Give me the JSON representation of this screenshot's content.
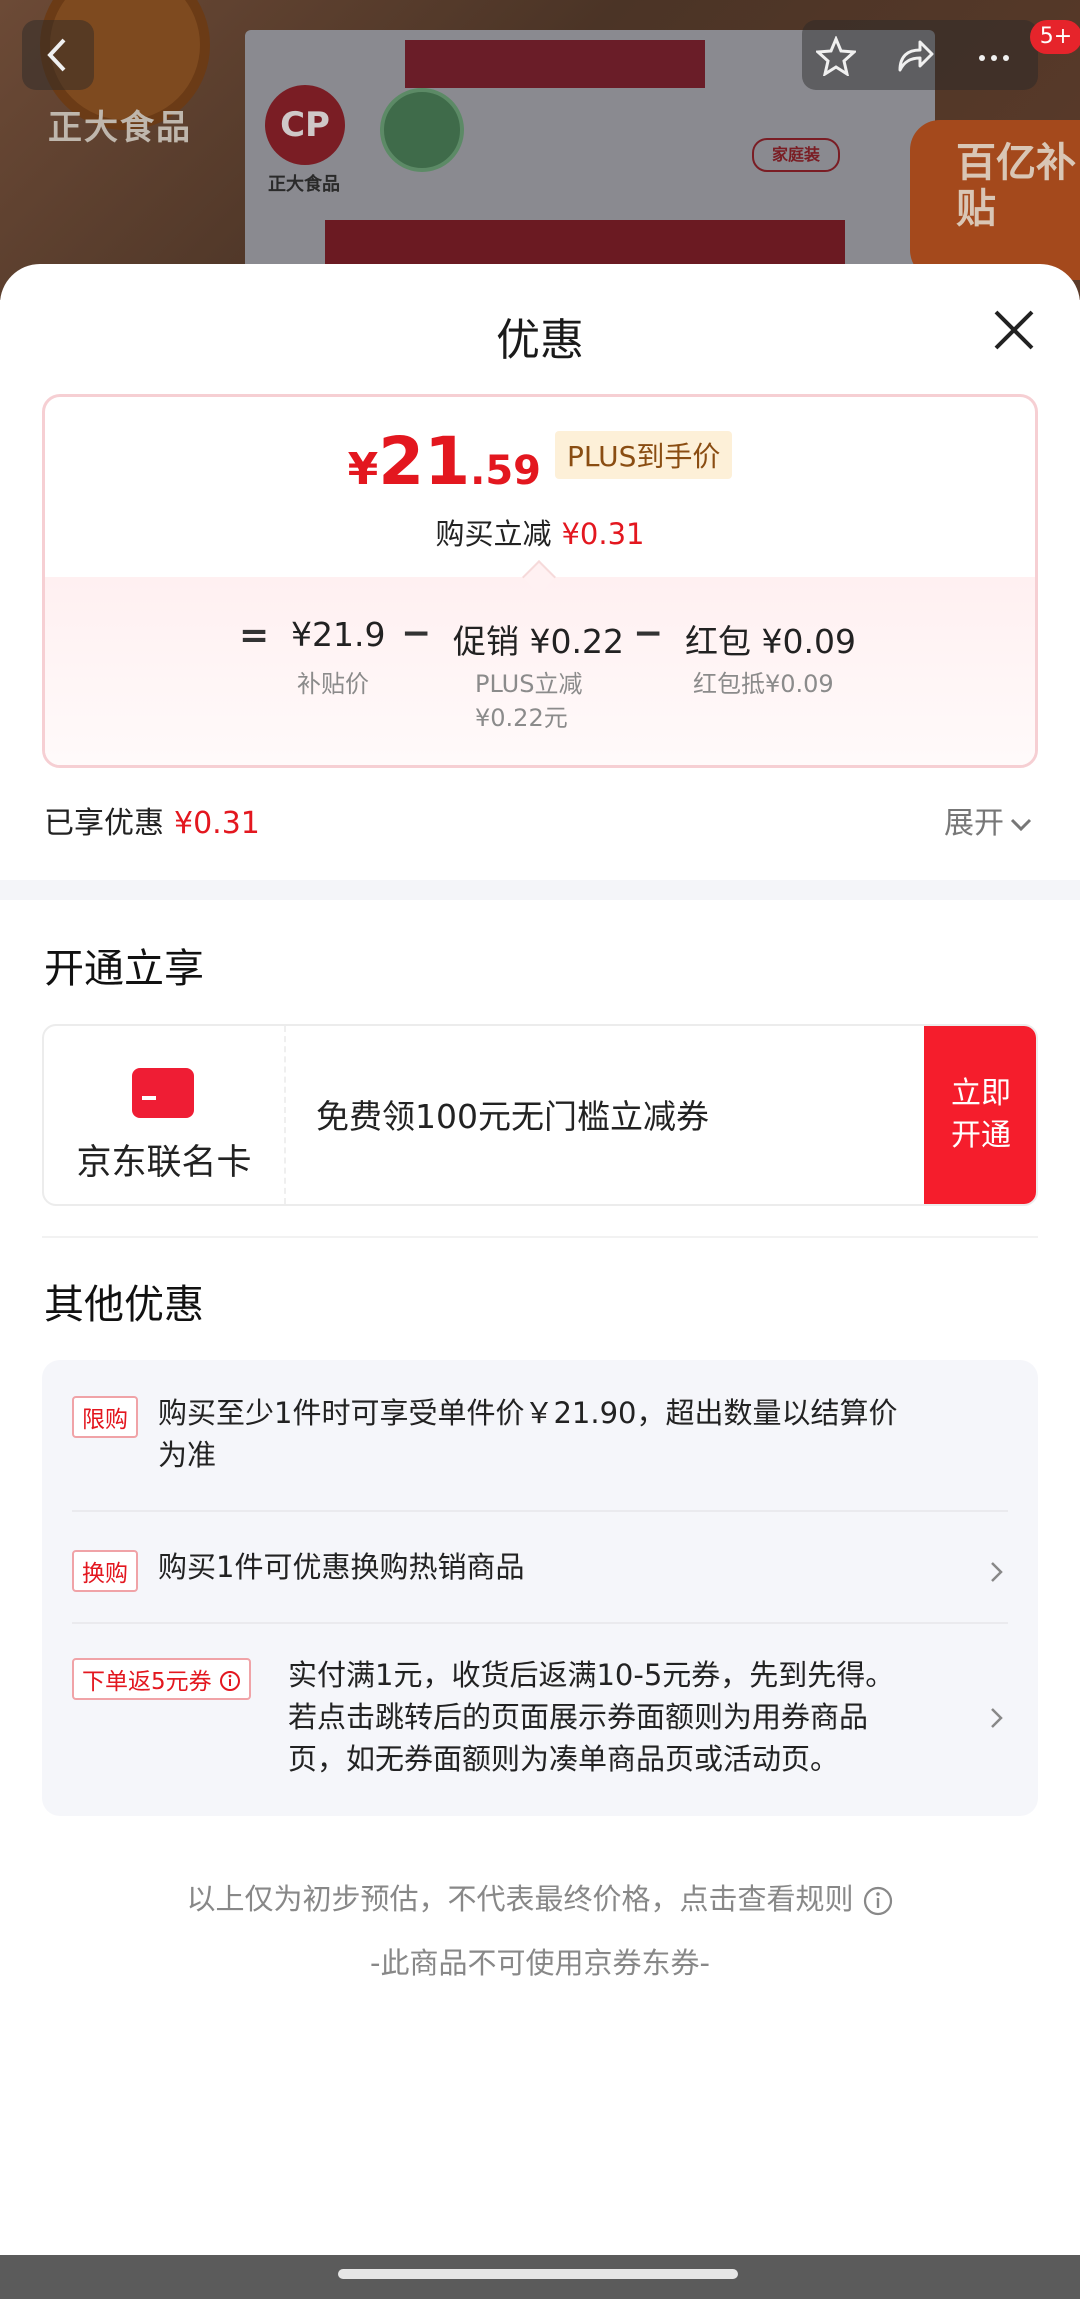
{
  "background": {
    "brand_text": "正大食品",
    "logo_text": "CP",
    "package_tag": "家庭装",
    "subsidy_badge": "百亿补贴",
    "notification_count": "5+"
  },
  "sheet": {
    "title": "优惠"
  },
  "price": {
    "currency": "¥",
    "integer": "21",
    "decimal": ".59",
    "tag": "PLUS到手价",
    "save_label": "购买立减",
    "save_amount": "¥0.31"
  },
  "breakdown": {
    "equals": "=",
    "minus": "−",
    "items": [
      {
        "label": "¥21.9",
        "sub": "补贴价"
      },
      {
        "label": "促销 ¥0.22",
        "sub_line1": "PLUS立减",
        "sub_line2": "¥0.22元"
      },
      {
        "label": "红包 ¥0.09",
        "sub": "红包抵¥0.09"
      }
    ]
  },
  "enjoyed": {
    "label": "已享优惠",
    "amount": "¥0.31",
    "expand": "展开"
  },
  "open_section": {
    "title": "开通立享",
    "card_name": "京东联名卡",
    "card_desc": "免费领100元无门槛立减券",
    "button_line1": "立即",
    "button_line2": "开通"
  },
  "other_section": {
    "title": "其他优惠",
    "rows": [
      {
        "tag": "限购",
        "line1": "购买至少1件时可享受单件价￥21.90，超出数量以结算价",
        "line2": "为准"
      },
      {
        "tag": "换购",
        "line1": "购买1件可优惠换购热销商品"
      },
      {
        "tag": "下单返5元券",
        "line1": "实付满1元，收货后返满10-5元券，先到先得。",
        "line2": "若点击跳转后的页面展示券面额则为用券商品",
        "line3": "页，如无券面额则为凑单商品页或活动页。"
      }
    ]
  },
  "footer": {
    "note": "以上仅为初步预估，不代表最终价格，点击查看规则",
    "note2": "-此商品不可使用京券东券-"
  },
  "colors": {
    "accent_red": "#e3171f",
    "button_red": "#f51d2c",
    "plus_tag_bg": "#fdf0d8"
  }
}
